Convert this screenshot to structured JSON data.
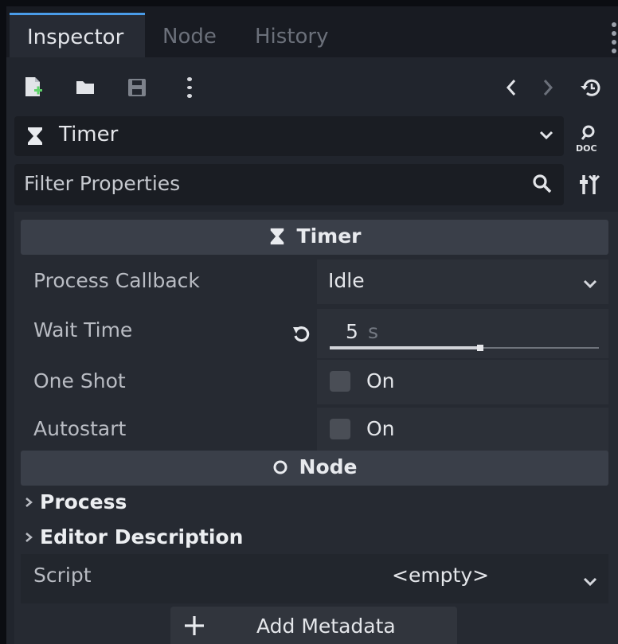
{
  "tabs": {
    "inspector": "Inspector",
    "node": "Node",
    "history": "History"
  },
  "object_selector": {
    "label": "Timer"
  },
  "filter": {
    "placeholder": "Filter Properties"
  },
  "sections": {
    "timer": {
      "title": "Timer",
      "process_callback": {
        "label": "Process Callback",
        "value": "Idle"
      },
      "wait_time": {
        "label": "Wait Time",
        "value": "5",
        "unit": "s",
        "slider_fraction": 0.56
      },
      "one_shot": {
        "label": "One Shot",
        "checkbox_text": "On",
        "checked": false
      },
      "autostart": {
        "label": "Autostart",
        "checkbox_text": "On",
        "checked": false
      }
    },
    "node": {
      "title": "Node",
      "groups": [
        "Process",
        "Editor Description"
      ],
      "script": {
        "label": "Script",
        "value": "<empty>"
      }
    }
  },
  "add_metadata": {
    "label": "Add Metadata"
  },
  "icons": {
    "new_resource": "new-resource-icon",
    "open": "folder-open-icon",
    "save": "save-icon",
    "more": "more-vertical-icon",
    "back": "chevron-left-icon",
    "forward": "chevron-right-icon",
    "history": "history-icon",
    "timer": "hourglass-icon",
    "doc": "doc-search-icon",
    "tune": "property-tune-icon",
    "revert": "revert-icon",
    "node": "node-circle-icon"
  },
  "colors": {
    "accent": "#4a9ce8",
    "green": "#5fd36a"
  }
}
